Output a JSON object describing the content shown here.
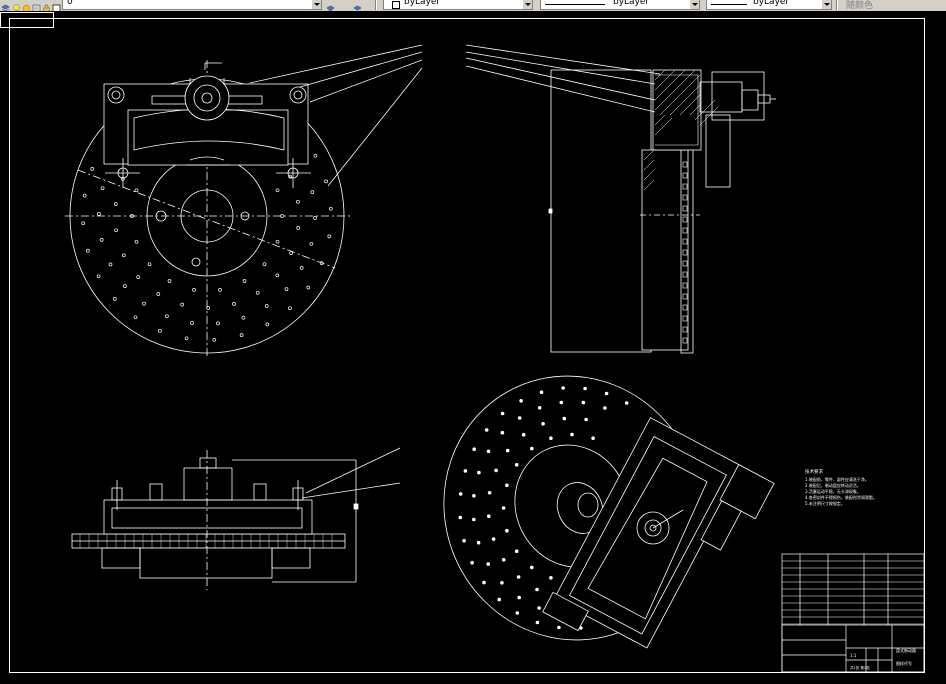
{
  "toolbar": {
    "layer_value": "0",
    "color_value": "byLayer",
    "linetype_value": "byLayer",
    "lineweight_value": "byLayer",
    "plotstyle_value": "随颜色"
  },
  "drawing": {
    "tech_requirements_title": "技术要求",
    "tech_requirements": [
      "1.装配前，零件、部件应清洗干净。",
      "2.装配后，制动盘应转动灵活。",
      "3.活塞运动平稳，无卡滞现象。",
      "4.各密封件不得损伤，装配时涂润滑脂。",
      "5.未注明尺寸按规定。"
    ],
    "title_block_name": "盘式制动器",
    "title_block_code": "图样代号",
    "title_block_scale": "1:1",
    "title_block_sheet": "共1张 第1张"
  }
}
